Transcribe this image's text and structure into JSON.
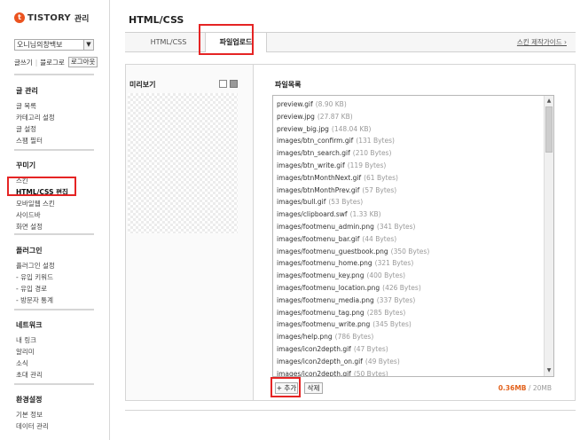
{
  "brand": {
    "logo_text": "TISTORY",
    "logo_sub": "관리"
  },
  "sidebar": {
    "blog_select": "오니님의창백보",
    "links": {
      "write": "글쓰기",
      "blog_home": "블로그로",
      "logout": "로그아웃"
    },
    "groups": [
      {
        "heading": "글 관리",
        "items": [
          "글 목록",
          "카테고리 설정",
          "글 설정",
          "스팸 필터"
        ]
      },
      {
        "heading": "꾸미기",
        "items": [
          "스킨",
          "HTML/CSS 편집",
          "모바일웹 스킨",
          "사이드바",
          "화면 설정"
        ]
      },
      {
        "heading": "플러그인",
        "items": [
          "플러그인 설정",
          "- 유입 키워드",
          "- 유입 경로",
          "- 방문자 통계"
        ]
      },
      {
        "heading": "네트워크",
        "items": [
          "내 링크",
          "알리미",
          "소식",
          "초대 관리"
        ]
      },
      {
        "heading": "환경설정",
        "items": [
          "기본 정보",
          "데이터 관리"
        ]
      }
    ]
  },
  "main": {
    "title": "HTML/CSS",
    "tabs": [
      "HTML/CSS",
      "파일업로드"
    ],
    "active_tab": 1,
    "skin_guide_link": "스킨 제작가이드 ›",
    "preview_label": "미리보기",
    "files_label": "파일목록",
    "files": [
      {
        "name": "preview.gif",
        "size": "(8.90 KB)"
      },
      {
        "name": "preview.jpg",
        "size": "(27.87 KB)"
      },
      {
        "name": "preview_big.jpg",
        "size": "(148.04 KB)"
      },
      {
        "name": "images/btn_confirm.gif",
        "size": "(131 Bytes)"
      },
      {
        "name": "images/btn_search.gif",
        "size": "(210 Bytes)"
      },
      {
        "name": "images/btn_write.gif",
        "size": "(119 Bytes)"
      },
      {
        "name": "images/btnMonthNext.gif",
        "size": "(61 Bytes)"
      },
      {
        "name": "images/btnMonthPrev.gif",
        "size": "(57 Bytes)"
      },
      {
        "name": "images/bull.gif",
        "size": "(53 Bytes)"
      },
      {
        "name": "images/clipboard.swf",
        "size": "(1.33 KB)"
      },
      {
        "name": "images/footmenu_admin.png",
        "size": "(341 Bytes)"
      },
      {
        "name": "images/footmenu_bar.gif",
        "size": "(44 Bytes)"
      },
      {
        "name": "images/footmenu_guestbook.png",
        "size": "(350 Bytes)"
      },
      {
        "name": "images/footmenu_home.png",
        "size": "(321 Bytes)"
      },
      {
        "name": "images/footmenu_key.png",
        "size": "(400 Bytes)"
      },
      {
        "name": "images/footmenu_location.png",
        "size": "(426 Bytes)"
      },
      {
        "name": "images/footmenu_media.png",
        "size": "(337 Bytes)"
      },
      {
        "name": "images/footmenu_tag.png",
        "size": "(285 Bytes)"
      },
      {
        "name": "images/footmenu_write.png",
        "size": "(345 Bytes)"
      },
      {
        "name": "images/help.png",
        "size": "(786 Bytes)"
      },
      {
        "name": "images/icon2depth.gif",
        "size": "(47 Bytes)"
      },
      {
        "name": "images/icon2depth_on.gif",
        "size": "(49 Bytes)"
      },
      {
        "name": "images/icon2depth.gif",
        "size": "(50 Bytes)"
      }
    ],
    "add_button": "+ 추가",
    "delete_button": "삭제",
    "quota_used": "0.36MB",
    "quota_total": "/ 20MB"
  },
  "colors": {
    "highlight_box": "#e52424",
    "logo": "#eb531f",
    "quota_used": "#e2621d"
  }
}
